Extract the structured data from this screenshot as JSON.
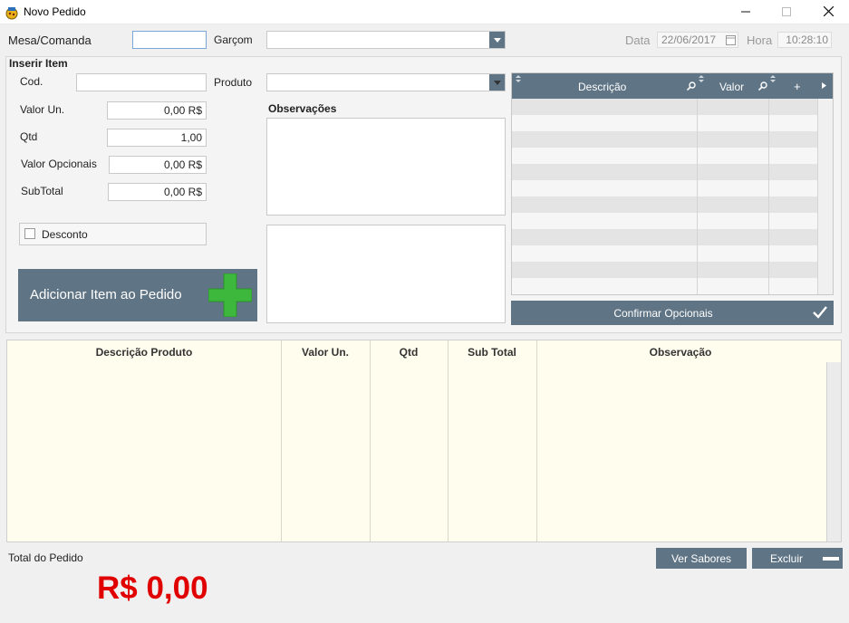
{
  "window": {
    "title": "Novo Pedido",
    "icon": "app-icon",
    "controls": {
      "minimize": "—",
      "maximize": "☐",
      "close": "✕"
    }
  },
  "header": {
    "mesa_label": "Mesa/Comanda",
    "mesa_value": "",
    "garcom_label": "Garçom",
    "garcom_value": "",
    "data_label": "Data",
    "data_value": "22/06/2017",
    "hora_label": "Hora",
    "hora_value": "10:28:10"
  },
  "insert": {
    "title": "Inserir Item",
    "cod_label": "Cod.",
    "cod_value": "",
    "produto_label": "Produto",
    "produto_value": "",
    "valor_un_label": "Valor Un.",
    "valor_un_value": "0,00 R$",
    "qtd_label": "Qtd",
    "qtd_value": "1,00",
    "valor_opc_label": "Valor Opcionais",
    "valor_opc_value": "0,00 R$",
    "subtotal_label": "SubTotal",
    "subtotal_value": "0,00 R$",
    "desconto_label": "Desconto",
    "desconto_checked": false,
    "observacoes_label": "Observações",
    "add_button": "Adicionar Item ao Pedido"
  },
  "opcionais": {
    "columns": [
      "Descrição",
      "Valor",
      "+"
    ],
    "row_count": 12,
    "confirm_button": "Confirmar Opcionais"
  },
  "order": {
    "columns": [
      "Descrição Produto",
      "Valor Un.",
      "Qtd",
      "Sub Total",
      "Observação"
    ],
    "rows": []
  },
  "footer": {
    "total_label": "Total do Pedido",
    "total_value": "R$ 0,00",
    "ver_sabores": "Ver Sabores",
    "excluir": "Excluir"
  },
  "colors": {
    "accent": "#5f7485",
    "total": "#e00000",
    "grid_bg": "#fffeee",
    "plus_green": "#3db83d"
  }
}
